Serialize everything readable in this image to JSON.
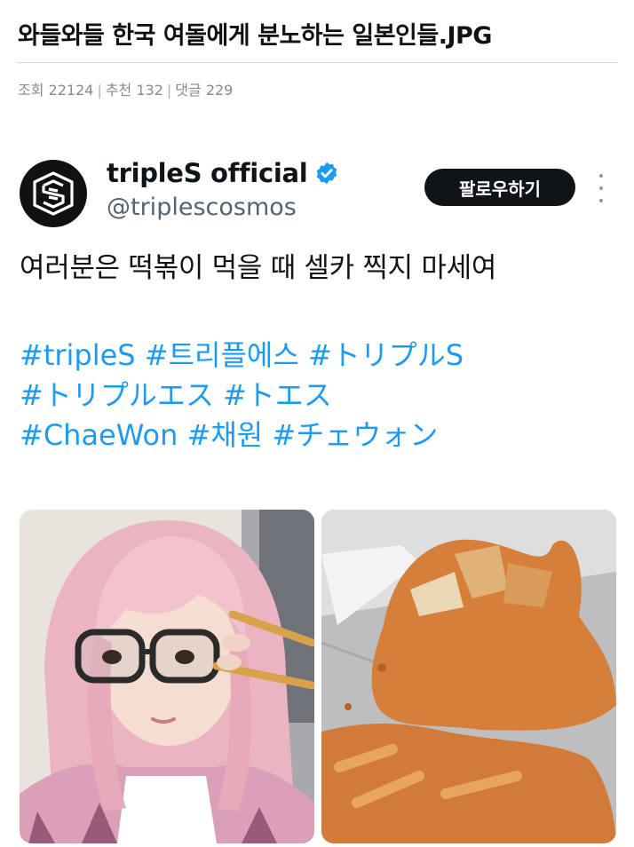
{
  "post": {
    "title": "와들와들 한국 여돌에게 분노하는 일본인들.JPG",
    "meta": {
      "views": "조회 22124",
      "recommends": "추천 132",
      "comments": "댓글 229"
    }
  },
  "tweet": {
    "display_name": "tripleS official",
    "handle": "@triplescosmos",
    "follow_label": "팔로우하기",
    "text": "여러분은 떡볶이 먹을 때 셀카 찍지 마세여",
    "hashtag_lines": [
      "#tripleS #트리플에스 #トリプルS",
      "#トリプルエス #トエス",
      "#ChaeWon #채원 #チェウォン"
    ],
    "icons": {
      "avatar": "triples-logo-icon",
      "verified": "verified-badge-icon",
      "more": "more-vertical-icon"
    }
  },
  "colors": {
    "link": "#1d9bf0",
    "verified": "#1d9bf0",
    "follow_bg": "#0f1419",
    "handle": "#536471",
    "meta": "#8a8a8a"
  }
}
